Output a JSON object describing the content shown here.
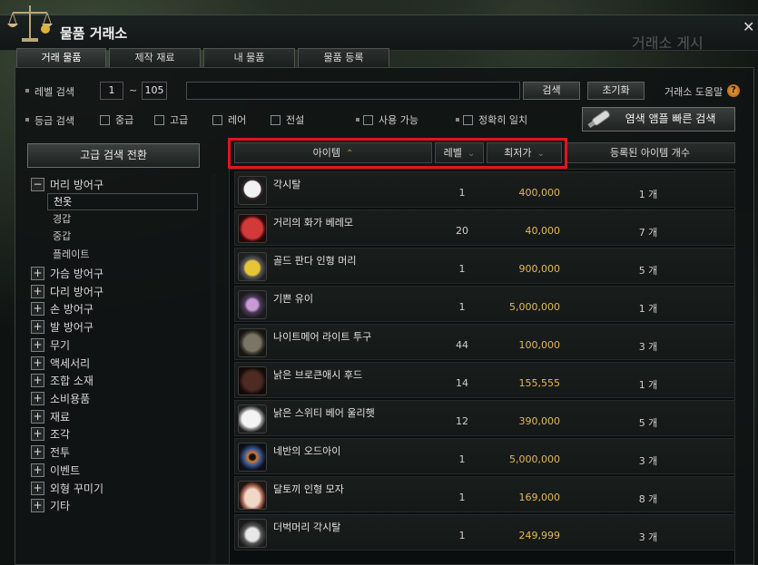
{
  "window": {
    "title": "물품 거래소",
    "bg_title": "거래소 게시",
    "close_glyph": "✕"
  },
  "tabs": [
    {
      "label": "거래 물품",
      "active": true
    },
    {
      "label": "제작 재료",
      "active": false
    },
    {
      "label": "내 물품",
      "active": false
    },
    {
      "label": "물품 등록",
      "active": false
    }
  ],
  "search": {
    "level_label": "레벨 검색",
    "level_min": "1",
    "level_sep": "~",
    "level_max": "105",
    "query": "",
    "search_btn": "검색",
    "reset_btn": "초기화",
    "help_label": "거래소 도움말",
    "help_glyph": "?",
    "grade_label": "등급 검색",
    "grades": [
      "중급",
      "고급",
      "레어",
      "전설"
    ],
    "usable_label": "사용 가능",
    "exact_label": "정확히 일치",
    "dye_btn": "염색 앰플 빠른 검색"
  },
  "left": {
    "advanced_btn": "고급 검색 전환",
    "expanded_category": "머리 방어구",
    "expanded_sign": "−",
    "subcategories": [
      {
        "label": "천옷",
        "selected": true
      },
      {
        "label": "경갑",
        "selected": false
      },
      {
        "label": "중갑",
        "selected": false
      },
      {
        "label": "플레이트",
        "selected": false
      }
    ],
    "collapsed_sign": "+",
    "categories": [
      "가슴 방어구",
      "다리 방어구",
      "손 방어구",
      "발 방어구",
      "무기",
      "액세서리",
      "조합 소재",
      "소비용품",
      "재료",
      "조각",
      "전투",
      "이벤트",
      "외형 꾸미기",
      "기타"
    ]
  },
  "table": {
    "headers": {
      "item": "아이템",
      "level": "레벨",
      "price": "최저가",
      "count": "등록된 아이템 개수"
    },
    "sort_up": "⌃",
    "sort_down": "⌄",
    "rows": [
      {
        "name": "각시탈",
        "level": "1",
        "price": "400,000",
        "count": "1 개"
      },
      {
        "name": "거리의 화가 베레모",
        "level": "20",
        "price": "40,000",
        "count": "7 개"
      },
      {
        "name": "골드 판다 인형 머리",
        "level": "1",
        "price": "900,000",
        "count": "5 개"
      },
      {
        "name": "기쁜 유이",
        "level": "1",
        "price": "5,000,000",
        "count": "1 개"
      },
      {
        "name": "나이트메어 라이트 투구",
        "level": "44",
        "price": "100,000",
        "count": "3 개"
      },
      {
        "name": "낡은 브로큰애시 후드",
        "level": "14",
        "price": "155,555",
        "count": "1 개"
      },
      {
        "name": "낡은 스위티 베어 울리햇",
        "level": "12",
        "price": "390,000",
        "count": "5 개"
      },
      {
        "name": "네반의 오드아이",
        "level": "1",
        "price": "5,000,000",
        "count": "3 개"
      },
      {
        "name": "달토끼 인형 모자",
        "level": "1",
        "price": "169,000",
        "count": "8 개"
      },
      {
        "name": "더벅머리 각시탈",
        "level": "1",
        "price": "249,999",
        "count": "3 개"
      }
    ]
  },
  "colors": {
    "highlight_frame": "#e0161c",
    "price": "#e7b95a",
    "sort_active": "#c68a3a"
  }
}
